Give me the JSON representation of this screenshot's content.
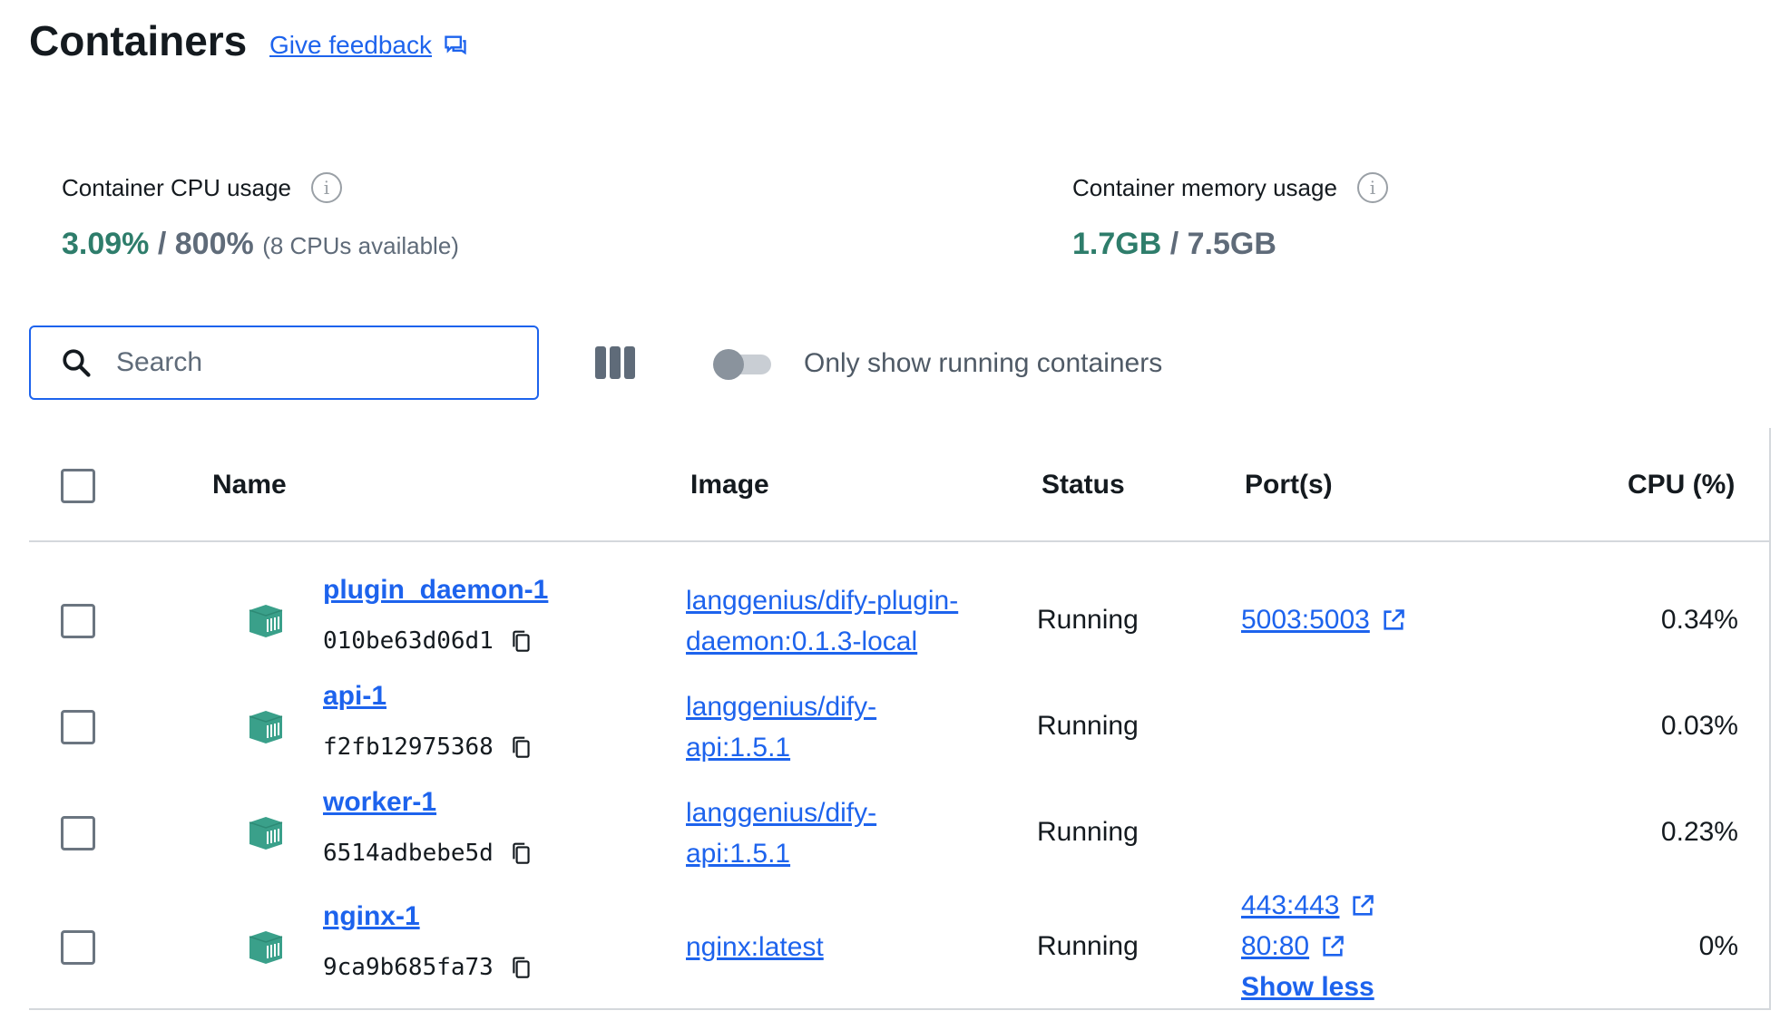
{
  "page": {
    "title": "Containers",
    "feedback_label": "Give feedback"
  },
  "stats": {
    "cpu": {
      "label": "Container CPU usage",
      "used": "3.09%",
      "separator": "/",
      "total": "800%",
      "note": "(8 CPUs available)"
    },
    "memory": {
      "label": "Container memory usage",
      "used": "1.7GB",
      "separator": "/",
      "total": "7.5GB"
    }
  },
  "toolbar": {
    "search_placeholder": "Search",
    "search_value": "",
    "toggle_label": "Only show running containers",
    "toggle_on": false
  },
  "table": {
    "headers": {
      "name": "Name",
      "image": "Image",
      "status": "Status",
      "ports": "Port(s)",
      "cpu": "CPU (%)"
    },
    "rows": [
      {
        "name": "plugin_daemon-1",
        "id": "010be63d06d1",
        "image_line1": "langgenius/dify-plugin-",
        "image_line2": "daemon:0.1.3-local",
        "status": "Running",
        "ports": [
          "5003:5003"
        ],
        "cpu": "0.34%"
      },
      {
        "name": "api-1",
        "id": "f2fb12975368",
        "image_line1": "langgenius/dify-",
        "image_line2": "api:1.5.1",
        "status": "Running",
        "ports": [],
        "cpu": "0.03%"
      },
      {
        "name": "worker-1",
        "id": "6514adbebe5d",
        "image_line1": "langgenius/dify-",
        "image_line2": "api:1.5.1",
        "status": "Running",
        "ports": [],
        "cpu": "0.23%"
      },
      {
        "name": "nginx-1",
        "id": "9ca9b685fa73",
        "image_line1": "nginx:latest",
        "image_line2": "",
        "status": "Running",
        "ports": [
          "443:443",
          "80:80"
        ],
        "ports_toggle": "Show less",
        "cpu": "0%"
      }
    ]
  },
  "colors": {
    "accent": "#1d63ed",
    "running_icon": "#3aa08a",
    "stat_green": "#2e7d6b"
  }
}
